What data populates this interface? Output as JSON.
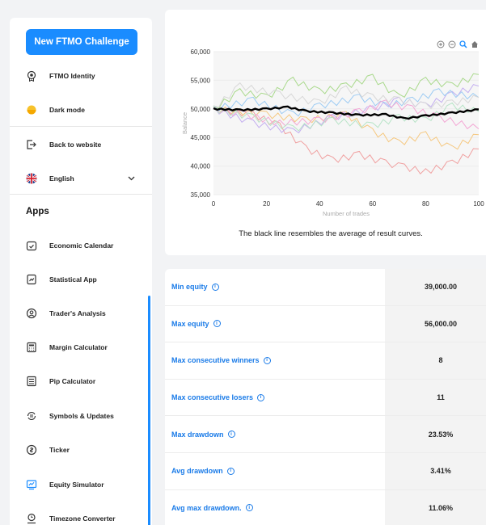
{
  "sidebar": {
    "cta_label": "New FTMO Challenge",
    "items": [
      {
        "label": "FTMO Identity",
        "icon": "badge-icon"
      },
      {
        "label": "Dark mode",
        "icon": "moon-toggle-icon"
      },
      {
        "label": "Back to website",
        "icon": "exit-icon"
      },
      {
        "label": "English",
        "icon": "uk-flag-icon"
      }
    ],
    "apps_heading": "Apps",
    "apps": [
      {
        "label": "Economic Calendar",
        "icon": "calendar-icon"
      },
      {
        "label": "Statistical App",
        "icon": "stats-icon"
      },
      {
        "label": "Trader's Analysis",
        "icon": "analysis-icon"
      },
      {
        "label": "Margin Calculator",
        "icon": "calculator-icon"
      },
      {
        "label": "Pip Calculator",
        "icon": "pip-calculator-icon"
      },
      {
        "label": "Symbols & Updates",
        "icon": "symbols-icon"
      },
      {
        "label": "Ticker",
        "icon": "ticker-icon"
      },
      {
        "label": "Equity Simulator",
        "icon": "simulator-icon"
      },
      {
        "label": "Timezone Converter",
        "icon": "timezone-icon"
      }
    ]
  },
  "chart_data": {
    "type": "line",
    "xlabel": "Number of trades",
    "ylabel": "Balance",
    "xlim": [
      0,
      100
    ],
    "ylim": [
      35000,
      60000
    ],
    "x_ticks": [
      "0",
      "20",
      "40",
      "60",
      "80",
      "100"
    ],
    "y_ticks": [
      "35,000",
      "40,000",
      "45,000",
      "50,000",
      "55,000",
      "60,000"
    ],
    "average_line": {
      "color": "#000000",
      "x": [
        0,
        10,
        20,
        28,
        35,
        45,
        55,
        65,
        72,
        80,
        90,
        100
      ],
      "y": [
        50000,
        49800,
        50000,
        50300,
        49600,
        49300,
        48900,
        49000,
        48300,
        48800,
        49300,
        49900
      ]
    },
    "series_lines": [
      {
        "color": "#f0a0a0",
        "x": [
          0,
          15,
          25,
          35,
          45,
          55,
          65,
          72,
          80,
          90,
          100
        ],
        "y": [
          50000,
          49000,
          47000,
          43000,
          41000,
          42000,
          40500,
          39800,
          39000,
          40500,
          43000
        ]
      },
      {
        "color": "#f5c77e",
        "x": [
          0,
          20,
          35,
          50,
          60,
          70,
          80,
          90,
          100
        ],
        "y": [
          50000,
          49000,
          48000,
          49000,
          46000,
          44000,
          45500,
          43000,
          45500
        ]
      },
      {
        "color": "#a9d98c",
        "x": [
          0,
          10,
          20,
          30,
          40,
          50,
          60,
          70,
          80,
          90,
          100
        ],
        "y": [
          50000,
          53000,
          52000,
          55000,
          53000,
          54000,
          55500,
          52000,
          55000,
          54000,
          56000
        ]
      },
      {
        "color": "#c3aef0",
        "x": [
          0,
          15,
          30,
          45,
          60,
          70,
          80,
          90,
          100
        ],
        "y": [
          50000,
          47500,
          46000,
          48500,
          50000,
          51500,
          50500,
          52500,
          54000
        ]
      },
      {
        "color": "#9ccbf3",
        "x": [
          0,
          15,
          30,
          40,
          55,
          65,
          75,
          85,
          100
        ],
        "y": [
          50000,
          51500,
          49000,
          50500,
          52000,
          50500,
          51500,
          53000,
          52000
        ]
      },
      {
        "color": "#f3a6d4",
        "x": [
          0,
          12,
          25,
          40,
          55,
          65,
          75,
          85,
          100
        ],
        "y": [
          50000,
          49000,
          47500,
          48000,
          49500,
          51000,
          50000,
          48500,
          46500
        ]
      },
      {
        "color": "#d7d7d7",
        "x": [
          0,
          10,
          25,
          40,
          50,
          60,
          70,
          80,
          90,
          100
        ],
        "y": [
          50000,
          54000,
          52500,
          51000,
          53500,
          52000,
          51500,
          50500,
          51000,
          52000
        ]
      },
      {
        "color": "#b7e4c7",
        "x": [
          0,
          15,
          30,
          45,
          60,
          70,
          80,
          90,
          100
        ],
        "y": [
          50000,
          48500,
          46500,
          48000,
          47000,
          48500,
          48000,
          50500,
          49500
        ]
      }
    ],
    "caption": "The black line resembles the average of result curves."
  },
  "stats": [
    {
      "label": "Min equity",
      "value": "39,000.00"
    },
    {
      "label": "Max equity",
      "value": "56,000.00"
    },
    {
      "label": "Max consecutive winners",
      "value": "8"
    },
    {
      "label": "Max consecutive losers",
      "value": "11"
    },
    {
      "label": "Max drawdown",
      "value": "23.53%"
    },
    {
      "label": "Avg drawdown",
      "value": "3.41%"
    },
    {
      "label": "Avg max drawdown.",
      "value": "11.06%"
    }
  ],
  "colors": {
    "accent": "#1a8cff",
    "link": "#1a7be8"
  }
}
